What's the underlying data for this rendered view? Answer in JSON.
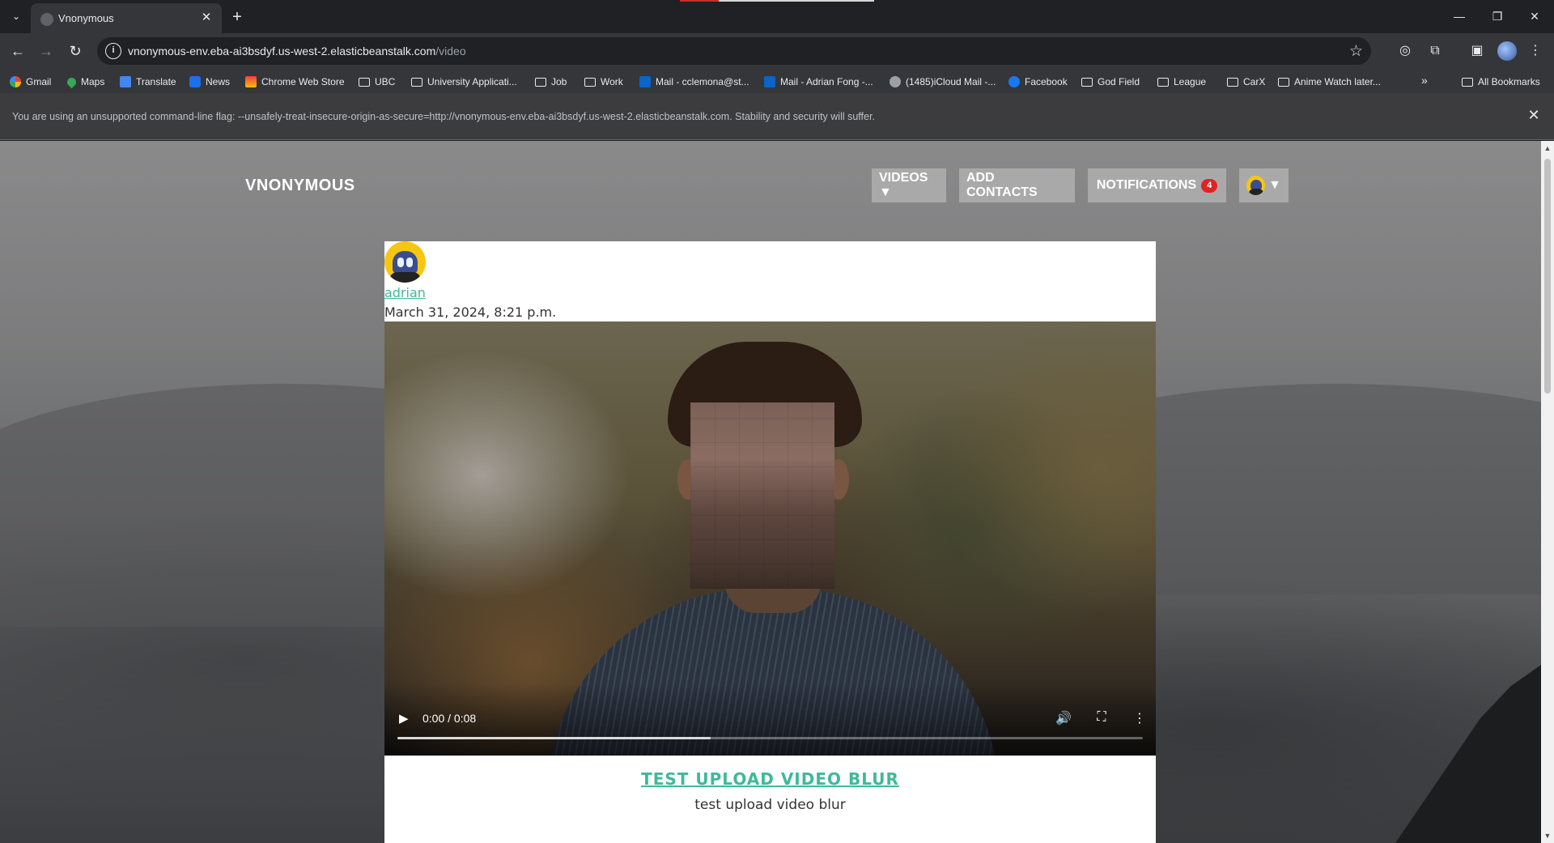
{
  "browser": {
    "tab_title": "Vnonymous",
    "url_host": "vnonymous-env.eba-ai3bsdyf.us-west-2.elasticbeanstalk.com",
    "url_path": "/video",
    "bookmarks": [
      {
        "label": "Gmail",
        "icon": "gmail-icon"
      },
      {
        "label": "Maps",
        "icon": "maps-icon"
      },
      {
        "label": "Translate",
        "icon": "translate-icon"
      },
      {
        "label": "News",
        "icon": "news-icon"
      },
      {
        "label": "Chrome Web Store",
        "icon": "chrome-web-store-icon"
      },
      {
        "label": "UBC",
        "icon": "folder-icon"
      },
      {
        "label": "University Applicati...",
        "icon": "folder-icon"
      },
      {
        "label": "Job",
        "icon": "folder-icon"
      },
      {
        "label": "Work",
        "icon": "folder-icon"
      },
      {
        "label": "Mail - cclemona@st...",
        "icon": "outlook-icon"
      },
      {
        "label": "Mail - Adrian Fong -...",
        "icon": "outlook-icon"
      },
      {
        "label": "(1485)iCloud Mail -...",
        "icon": "apple-icon"
      },
      {
        "label": "Facebook",
        "icon": "facebook-icon"
      },
      {
        "label": "God Field",
        "icon": "folder-icon"
      },
      {
        "label": "League",
        "icon": "folder-icon"
      },
      {
        "label": "CarX",
        "icon": "folder-icon"
      },
      {
        "label": "Anime Watch later...",
        "icon": "folder-icon"
      }
    ],
    "all_bookmarks_label": "All Bookmarks",
    "infobar_text": "You are using an unsupported command-line flag: --unsafely-treat-insecure-origin-as-secure=http://vnonymous-env.eba-ai3bsdyf.us-west-2.elasticbeanstalk.com. Stability and security will suffer."
  },
  "site": {
    "brand": "VNONYMOUS",
    "nav": {
      "videos_label": "VIDEOS ▼",
      "add_contacts_label": "ADD CONTACTS",
      "notifications_label": "NOTIFICATIONS",
      "notifications_count": "4",
      "profile_caret": "▼"
    }
  },
  "post": {
    "author": "adrian",
    "date": "March 31, 2024, 8:21 p.m.",
    "video": {
      "time": "0:00 / 0:08",
      "buffered_fraction": 0.42
    },
    "title": "TEST UPLOAD VIDEO BLUR",
    "description": "test upload video blur"
  },
  "colors": {
    "accent": "#3fb99b",
    "badge": "#e02424",
    "nav_button": "#a9a9aa"
  }
}
